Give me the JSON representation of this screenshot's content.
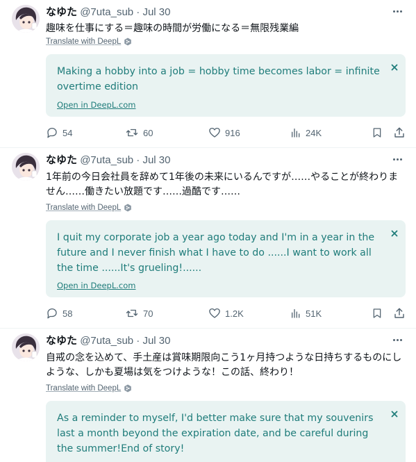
{
  "tweets": [
    {
      "author": "なゆた",
      "handle_date": "@7uta_sub · Jul 30",
      "original_text": "趣味を仕事にする＝趣味の時間が労働になる＝無限残業編",
      "translate_label": "Translate with DeepL",
      "translation": "Making a hobby into a job = hobby time becomes labor = infinite overtime edition",
      "open_label": "Open in DeepL.com",
      "replies": "54",
      "reposts": "60",
      "likes": "916",
      "views": "24K"
    },
    {
      "author": "なゆた",
      "handle_date": "@7uta_sub · Jul 30",
      "original_text": "1年前の今日会社員を辞めて1年後の未来にいるんですが……やることが終わりません……働きたい放題です……過酷です……",
      "translate_label": "Translate with DeepL",
      "translation": "I quit my corporate job a year ago today and I'm in a year in the future and I never finish what I have to do ......I want to work all the time ......It's grueling!......",
      "open_label": "Open in DeepL.com",
      "replies": "58",
      "reposts": "70",
      "likes": "1.2K",
      "views": "51K"
    },
    {
      "author": "なゆた",
      "handle_date": "@7uta_sub · Jul 30",
      "original_text": "自戒の念を込めて、手土産は賞味期限向こう1ヶ月持つような日持ちするものにしような、しかも夏場は気をつけような！この話、終わり！",
      "translate_label": "Translate with DeepL",
      "translation": "As a reminder to myself, I'd better make sure that my souvenirs last a month beyond the expiration date, and be careful during the summer!End of story!"
    }
  ],
  "colors": {
    "translation_bg": "#e9f3f2",
    "translation_text": "#1f7c7a",
    "secondary_text": "#536471"
  },
  "icons": [
    "more-icon",
    "deepl-icon",
    "close-icon",
    "reply-icon",
    "repost-icon",
    "like-icon",
    "views-icon",
    "bookmark-icon",
    "share-icon"
  ]
}
